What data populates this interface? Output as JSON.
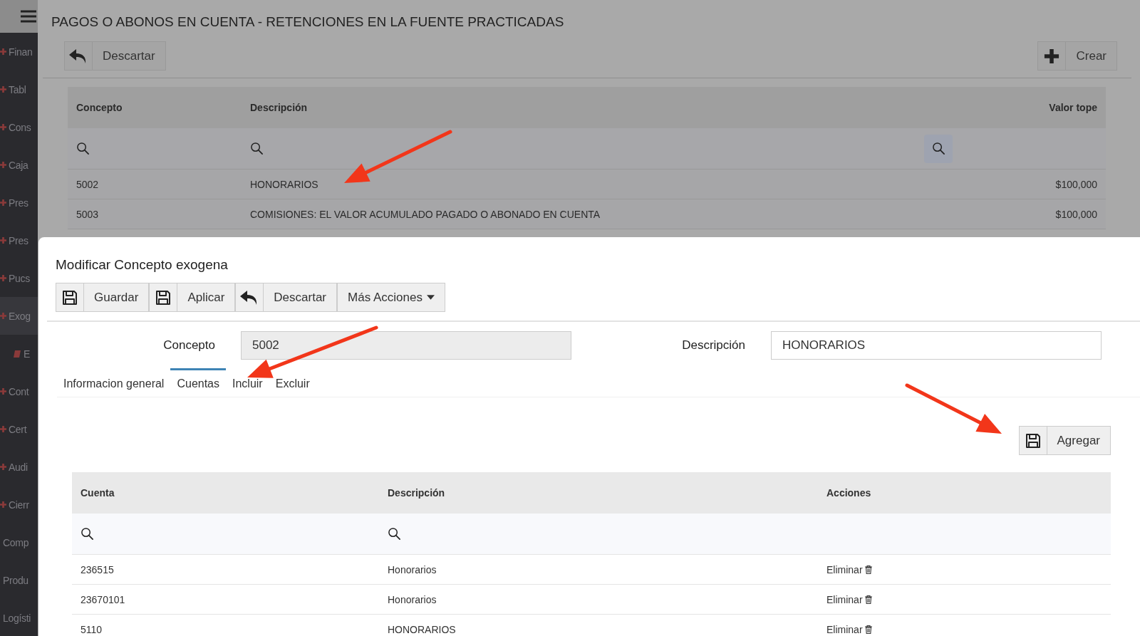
{
  "sidebar": {
    "items": [
      {
        "label": "Finan",
        "kind": "module",
        "selected": false
      },
      {
        "label": "Tabl",
        "kind": "module",
        "selected": false
      },
      {
        "label": "Cons",
        "kind": "module",
        "selected": false
      },
      {
        "label": "Caja",
        "kind": "module",
        "selected": false
      },
      {
        "label": "Pres",
        "kind": "module",
        "selected": false
      },
      {
        "label": "Pres",
        "kind": "module",
        "selected": false
      },
      {
        "label": "Pucs",
        "kind": "module",
        "selected": false
      },
      {
        "label": "Exog",
        "kind": "module",
        "selected": true
      },
      {
        "label": "E",
        "kind": "sub",
        "selected": false
      },
      {
        "label": "Cont",
        "kind": "module",
        "selected": false
      },
      {
        "label": "Cert",
        "kind": "module",
        "selected": false
      },
      {
        "label": "Audi",
        "kind": "module",
        "selected": false
      },
      {
        "label": "Cierr",
        "kind": "module",
        "selected": false
      },
      {
        "label": "Comp",
        "kind": "link",
        "selected": false
      },
      {
        "label": "Produ",
        "kind": "link",
        "selected": false
      },
      {
        "label": "Logísti",
        "kind": "link",
        "selected": false
      }
    ]
  },
  "page": {
    "title": "PAGOS O ABONOS EN CUENTA - RETENCIONES EN LA FUENTE PRACTICADAS",
    "toolbar": [
      {
        "label": "Descartar"
      }
    ],
    "create_button": {
      "label": "Crear"
    }
  },
  "table": {
    "columns": [
      "Concepto",
      "Descripción",
      "Valor tope"
    ],
    "rows": [
      [
        "5002",
        "HONORARIOS",
        "$100,000"
      ],
      [
        "5003",
        "COMISIONES: EL VALOR ACUMULADO PAGADO O ABONADO EN CUENTA",
        "$100,000"
      ]
    ]
  },
  "modal": {
    "title": "Modificar Concepto exogena",
    "toolbar": [
      {
        "label": "Guardar",
        "kind": "button"
      },
      {
        "label": "Aplicar",
        "kind": "button"
      },
      {
        "label": "Descartar",
        "kind": "button"
      },
      {
        "label": "Más Acciones",
        "kind": "menu"
      }
    ],
    "fields": [
      {
        "label": "Concepto",
        "value": "5002",
        "disabled": true
      },
      {
        "label": "Descripción",
        "value": "HONORARIOS",
        "disabled": false
      }
    ],
    "tabs": [
      {
        "label": "Informacion general",
        "selected": false
      },
      {
        "label": "Cuentas",
        "selected": true
      },
      {
        "label": "Incluir",
        "selected": false
      },
      {
        "label": "Excluir",
        "selected": false
      }
    ],
    "add_button": {
      "label": "Agregar"
    },
    "table": {
      "columns": [
        "Cuenta",
        "Descripción",
        "Acciones"
      ],
      "rows": [
        {
          "cuenta": "236515",
          "descripcion": "Honorarios",
          "action": "Eliminar"
        },
        {
          "cuenta": "23670101",
          "descripcion": "Honorarios",
          "action": "Eliminar"
        },
        {
          "cuenta": "5110",
          "descripcion": "HONORARIOS",
          "action": "Eliminar"
        }
      ]
    }
  }
}
